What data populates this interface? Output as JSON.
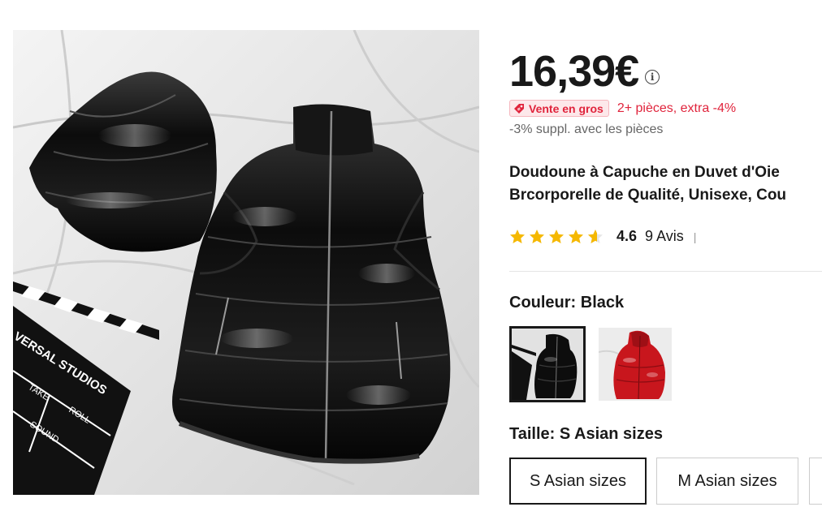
{
  "product": {
    "price": "16,39€",
    "price_info_icon": "info-icon",
    "bulk_badge": "Vente en gros",
    "bulk_badge_icon": "tag-icon",
    "bulk_offer": "2+ pièces, extra -4%",
    "extra_discount": "-3% suppl. avec les pièces",
    "title_line1": "Doudoune à Capuche en Duvet d'Oie",
    "title_line2": "Brcorporelle de Qualité, Unisexe, Cou",
    "rating": {
      "stars": 4.6,
      "value": "4.6",
      "reviews": "9 Avis",
      "separator": "|"
    },
    "color": {
      "label": "Couleur: Black",
      "options": [
        {
          "name": "Black",
          "swatch": "#111111",
          "selected": true
        },
        {
          "name": "Red",
          "swatch": "#c8161d",
          "selected": false
        }
      ]
    },
    "size": {
      "label": "Taille: S Asian sizes",
      "options": [
        {
          "label": "S Asian sizes",
          "selected": true
        },
        {
          "label": "M Asian sizes",
          "selected": false
        },
        {
          "label": "",
          "selected": false
        }
      ]
    },
    "image_text": {
      "clapper_top": "VERSAL STUDIOS",
      "clapper_take": "TAKE",
      "clapper_roll": "ROLL",
      "clapper_sound": "SOUND"
    }
  },
  "colors": {
    "accent_red": "#e0243c",
    "badge_bg": "#fde8ea",
    "star": "#f5b800",
    "text": "#191919",
    "muted": "#666666"
  }
}
